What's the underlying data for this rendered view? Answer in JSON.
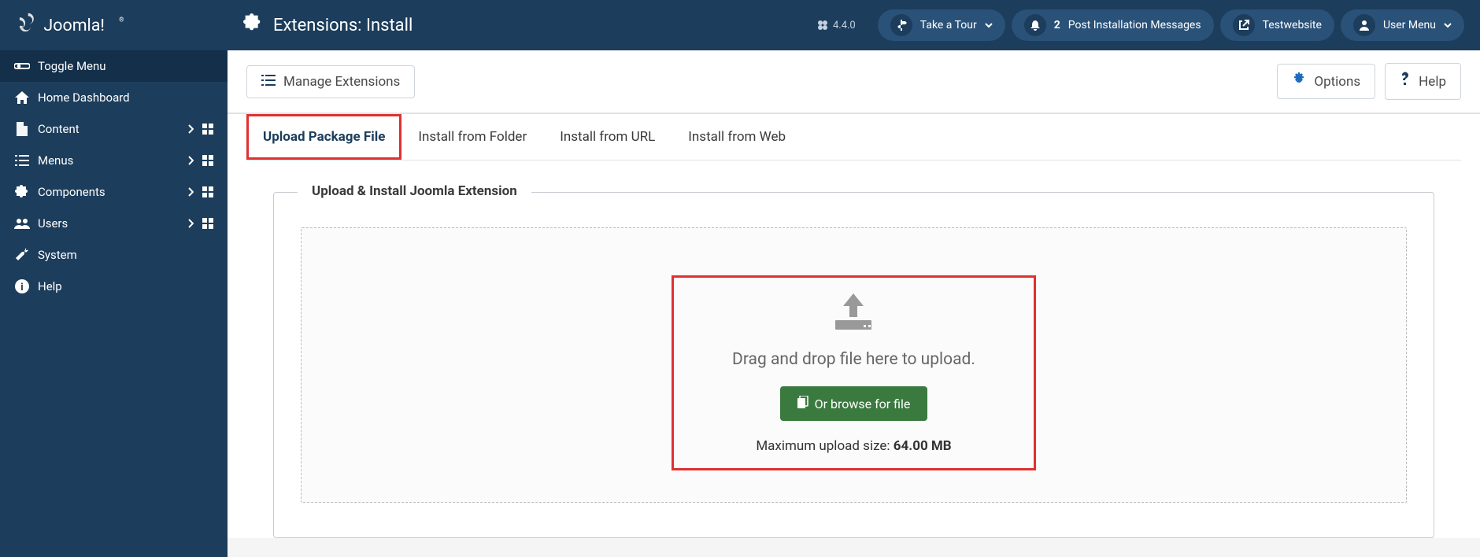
{
  "brand": "Joomla!",
  "version": "4.4.0",
  "page_title": "Extensions: Install",
  "topbar": {
    "tour": "Take a Tour",
    "notif_count": "2",
    "post_install": "Post Installation Messages",
    "site_name": "Testwebsite",
    "user_menu": "User Menu"
  },
  "sidebar": {
    "toggle": "Toggle Menu",
    "items": [
      {
        "label": "Home Dashboard",
        "expandable": false
      },
      {
        "label": "Content",
        "expandable": true
      },
      {
        "label": "Menus",
        "expandable": true
      },
      {
        "label": "Components",
        "expandable": true
      },
      {
        "label": "Users",
        "expandable": true
      },
      {
        "label": "System",
        "expandable": false
      },
      {
        "label": "Help",
        "expandable": false
      }
    ]
  },
  "toolbar": {
    "manage": "Manage Extensions",
    "options": "Options",
    "help": "Help"
  },
  "tabs": [
    "Upload Package File",
    "Install from Folder",
    "Install from URL",
    "Install from Web"
  ],
  "panel": {
    "legend": "Upload & Install Joomla Extension",
    "drop_text": "Drag and drop file here to upload.",
    "browse_label": "Or browse for file",
    "max_label": "Maximum upload size: ",
    "max_value": "64.00 MB"
  }
}
